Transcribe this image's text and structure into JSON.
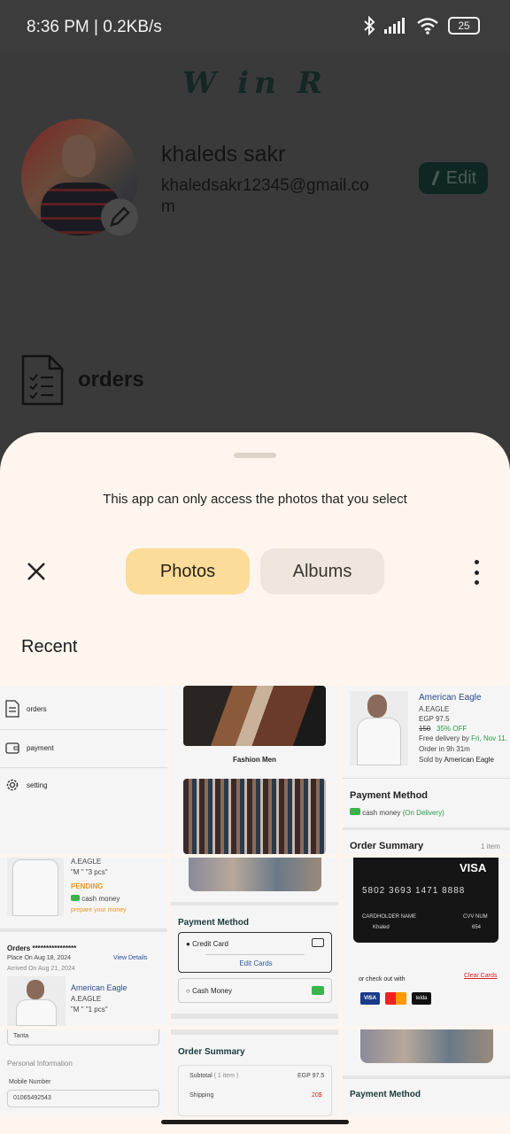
{
  "status": {
    "time": "8:36 PM | 0.2KB/s",
    "battery": "25"
  },
  "app": {
    "brand": "W in R",
    "profile": {
      "name": "khaleds sakr",
      "email": "khaledsakr12345@gmail.com"
    },
    "edit_label": "Edit",
    "orders_label": "orders"
  },
  "sheet": {
    "info": "This app can only access the photos that you select",
    "tabs": [
      "Photos",
      "Albums"
    ],
    "section": "Recent"
  },
  "thumbs": {
    "t1": {
      "orders": "orders",
      "payment": "payment",
      "setting": "setting"
    },
    "t2": {
      "caption": "Fashion Men"
    },
    "t3": {
      "title": "American Eagle",
      "brand": "A.EAGLE",
      "price": "EGP 97.5",
      "old": "150",
      "off": "35% OFF",
      "delivery": "Free delivery",
      "delivery_by": "by",
      "delivery_date": "Fri, Nov 11.",
      "order_in": "Order in 9h 31m",
      "sold": "Sold by",
      "sold_brand": "American Eagle",
      "pm": "Payment Method",
      "cash": "cash money",
      "on_delivery": "(On Delivery)",
      "summary": "Order Summary",
      "items": "1 item"
    },
    "t4": {
      "brand": "A.EAGLE",
      "size": "\"M \" \"3 pcs\"",
      "status": "PENDING",
      "cash": "cash money",
      "prepare": "prepare your money",
      "orders": "Orders ****************",
      "placed": "Place On Aug 18, 2024",
      "view": "View Details",
      "arrived": "Arrived On Aug 21, 2024",
      "title2": "American Eagle",
      "brand2": "A.EAGLE",
      "size2": "\"M \" \"1 pcs\""
    },
    "t5": {
      "pm": "Payment Method",
      "credit": "Credit Card",
      "edit_cards": "Edit Cards",
      "cash": "Cash Money"
    },
    "t6": {
      "visa": "VISA",
      "number": "5802 3693 1471 8888",
      "holder_label": "CARDHOLDER NAME",
      "holder": "Khaled",
      "cvv_label": "CVV NUM",
      "cvv": "654",
      "checkout": "or check out with",
      "clear": "Clear Cards",
      "logos": [
        "VISA",
        "MC",
        "telda"
      ]
    },
    "t7": {
      "field": "Tanta",
      "section": "Personal Information",
      "label": "Mobile Number",
      "value": "01065492543"
    },
    "t8": {
      "summary": "Order Summary",
      "subtotal": "Subtotal",
      "items": "( 1 item )",
      "subtotal_val": "EGP 97.5",
      "shipping": "Shipping",
      "shipping_val": "20$"
    },
    "t9": {
      "pm": "Payment Method"
    }
  }
}
